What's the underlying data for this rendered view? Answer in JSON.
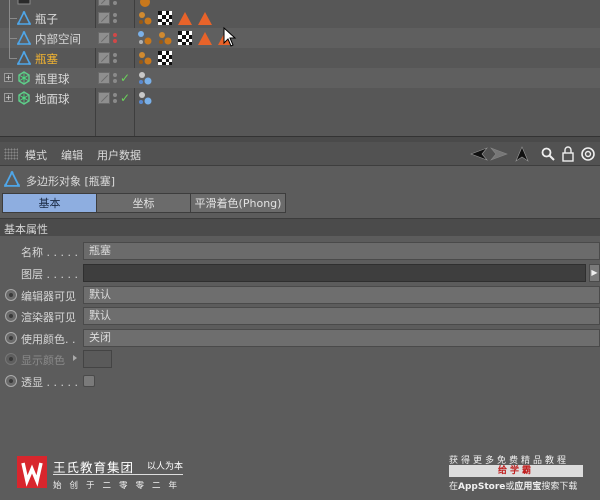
{
  "object_manager": {
    "rows": [
      {
        "name": "",
        "icon": "camera-icon",
        "active": false,
        "expander": false,
        "check": false
      },
      {
        "name": "瓶子",
        "icon": "polygon-object-icon",
        "active": false,
        "expander": false,
        "check": false
      },
      {
        "name": "内部空间",
        "icon": "polygon-object-icon",
        "active": false,
        "expander": false,
        "check": false
      },
      {
        "name": "瓶塞",
        "icon": "polygon-object-icon",
        "active": true,
        "expander": false,
        "check": false
      },
      {
        "name": "瓶里球",
        "icon": "sphere-object-icon",
        "active": false,
        "expander": true,
        "check": true
      },
      {
        "name": "地面球",
        "icon": "sphere-object-icon",
        "active": false,
        "expander": true,
        "check": true
      }
    ],
    "expander_symbol": "+",
    "check_symbol": "✓"
  },
  "menubar": {
    "items": [
      "模式",
      "编辑",
      "用户数据"
    ]
  },
  "attributes": {
    "title": "多边形对象 [瓶塞]",
    "tabs": [
      {
        "label": "基本",
        "active": true
      },
      {
        "label": "坐标",
        "active": false
      },
      {
        "label": "平滑着色(Phong)",
        "active": false
      }
    ],
    "section": "基本属性",
    "props": {
      "name": {
        "label": "名称 . . . . .",
        "value": "瓶塞"
      },
      "layer": {
        "label": "图层 . . . . .",
        "value": ""
      },
      "editor_visible": {
        "label": "编辑器可见",
        "value": "默认"
      },
      "render_visible": {
        "label": "渲染器可见",
        "value": "默认"
      },
      "use_color": {
        "label": "使用颜色. .",
        "value": "关闭"
      },
      "display_color": {
        "label": "显示颜色",
        "value": ""
      },
      "xray": {
        "label": "透显 . . . . .",
        "value": ""
      }
    }
  },
  "watermark_left": {
    "title": "王氏教育集团",
    "tag": "以人为本",
    "sub": "始创于二零零二年"
  },
  "watermark_right": {
    "line1": "获得更多免费精品教程",
    "line2": "给学霸",
    "line3_pre": "在",
    "line3_store": "AppStore",
    "line3_mid": "或",
    "line3_app": "应用宝",
    "line3_post": "搜索下载"
  },
  "colors": {
    "active_name": "#f2b431",
    "active_tab": "#8eaee0",
    "logo_red": "#d8262d",
    "check_green": "#6ad25a"
  }
}
